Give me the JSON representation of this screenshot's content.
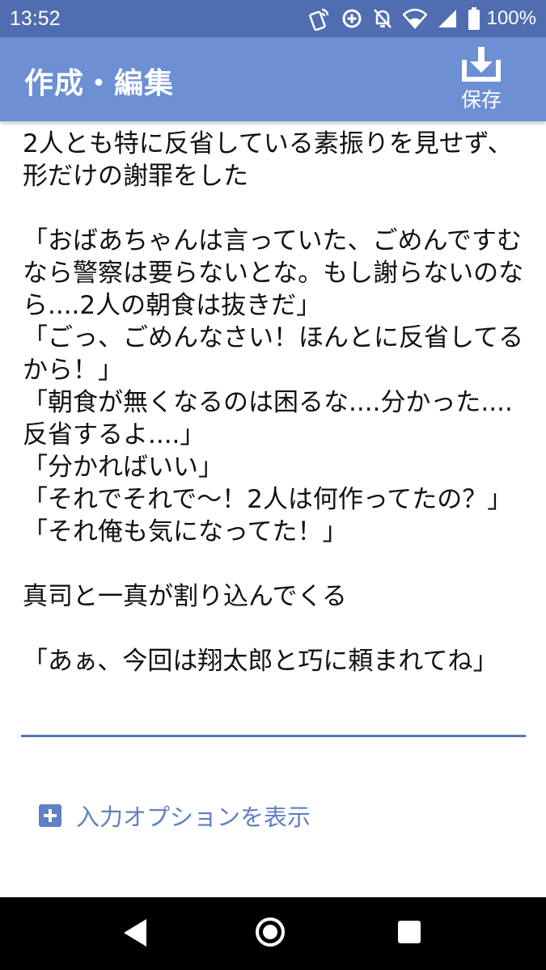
{
  "status_bar": {
    "time": "13:52",
    "battery": "100%",
    "icons": [
      "nfc-phone-icon",
      "data-saver-icon",
      "bell-off-icon",
      "wifi-icon",
      "signal-icon",
      "battery-icon"
    ]
  },
  "app_bar": {
    "title": "作成・編集",
    "save_label": "保存",
    "save_icon": "download-tray-icon"
  },
  "editor": {
    "text": "2人とも特に反省している素振りを見せず、形だけの謝罪をした\n\n「おばあちゃんは言っていた、ごめんですむなら警察は要らないとな。もし謝らないのなら....2人の朝食は抜きだ」\n「ごっ、ごめんなさい！ほんとに反省してるから！」\n「朝食が無くなるのは困るな....分かった....反省するよ....」\n「分かればいい」\n「それでそれで〜！2人は何作ってたの？」\n「それ俺も気になってた！」\n\n真司と一真が割り込んでくる\n\n「あぁ、今回は翔太郎と巧に頼まれてね」"
  },
  "options": {
    "label": "入力オプションを表示"
  },
  "colors": {
    "status_bar": "#4f6db0",
    "app_bar": "#6d8fd4",
    "accent": "#5f80c2"
  }
}
